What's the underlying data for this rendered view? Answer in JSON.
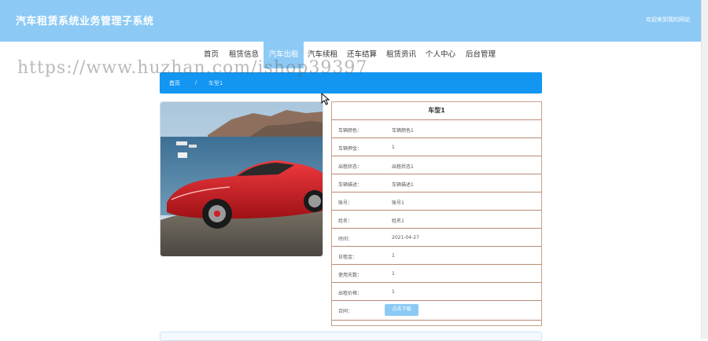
{
  "header": {
    "site_title": "汽车租赁系统业务管理子系统",
    "welcome": "欢迎来到我的网站"
  },
  "nav": {
    "items": [
      {
        "label": "首页"
      },
      {
        "label": "租赁信息"
      },
      {
        "label": "汽车出租"
      },
      {
        "label": "汽车续租"
      },
      {
        "label": "还车结算"
      },
      {
        "label": "租赁资讯"
      },
      {
        "label": "个人中心"
      },
      {
        "label": "后台管理"
      }
    ],
    "active_index": 2
  },
  "watermark": "https://www.huzhan.com/ishop39397",
  "breadcrumb": {
    "home": "首页",
    "separator": "/",
    "current": "车型1"
  },
  "image": {
    "icon": "car-photo",
    "description_color": "#d8252c"
  },
  "detail": {
    "title": "车型1",
    "rows": [
      {
        "label": "车辆颜色：",
        "value": "车辆颜色1"
      },
      {
        "label": "车辆押金：",
        "value": "1"
      },
      {
        "label": "出租状态：",
        "value": "出租状态1"
      },
      {
        "label": "车辆描述：",
        "value": "车辆描述1"
      },
      {
        "label": "账号：",
        "value": "账号1"
      },
      {
        "label": "姓名：",
        "value": "姓名1"
      },
      {
        "label": "时间：",
        "value": "2021-04-27"
      },
      {
        "label": "日租金：",
        "value": "1"
      },
      {
        "label": "使用天数：",
        "value": "1"
      },
      {
        "label": "出租价格：",
        "value": "1"
      }
    ],
    "contract_label": "合同：",
    "download_label": "点击下载"
  },
  "colors": {
    "header": "#8ccaf5",
    "breadcrumb": "#1296f2",
    "border": "#c8a08a"
  }
}
